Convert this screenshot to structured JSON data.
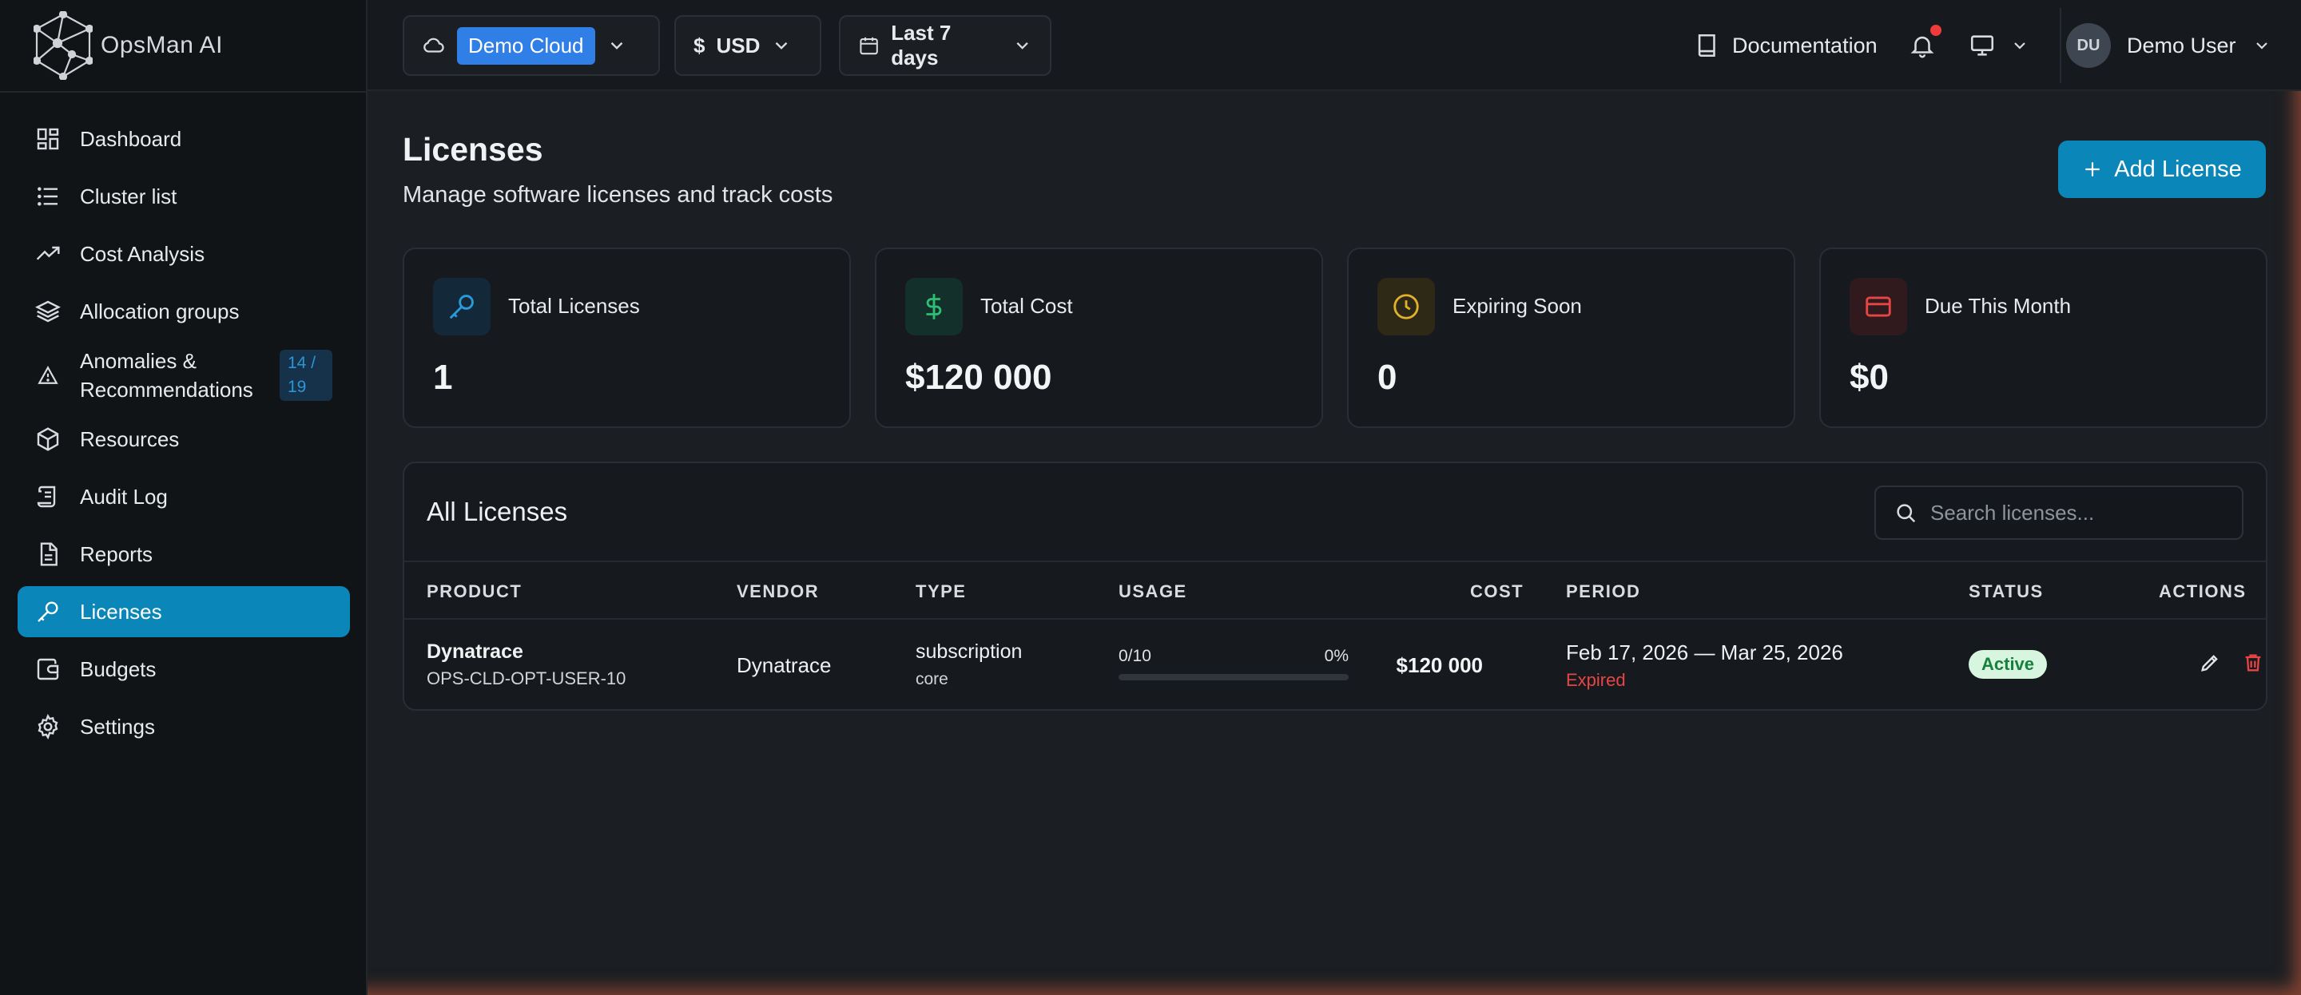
{
  "app": {
    "name": "OpsMan AI"
  },
  "sidebar": {
    "items": [
      {
        "label": "Dashboard",
        "icon": "dashboard-icon"
      },
      {
        "label": "Cluster list",
        "icon": "list-icon"
      },
      {
        "label": "Cost Analysis",
        "icon": "trend-icon"
      },
      {
        "label": "Allocation groups",
        "icon": "layers-icon"
      },
      {
        "label_line1": "Anomalies &",
        "label_line2": "Recommendations",
        "badge_line1": "14 /",
        "badge_line2": "19",
        "icon": "warning-icon"
      },
      {
        "label": "Resources",
        "icon": "cube-icon"
      },
      {
        "label": "Audit Log",
        "icon": "scroll-icon"
      },
      {
        "label": "Reports",
        "icon": "report-icon"
      },
      {
        "label": "Licenses",
        "icon": "key-icon",
        "active": true
      },
      {
        "label": "Budgets",
        "icon": "wallet-icon"
      },
      {
        "label": "Settings",
        "icon": "gear-icon"
      }
    ]
  },
  "topbar": {
    "cloud": "Demo Cloud",
    "currency_symbol": "$",
    "currency": "USD",
    "date_range": "Last 7 days",
    "documentation": "Documentation",
    "user_initials": "DU",
    "user_name": "Demo User"
  },
  "page": {
    "title": "Licenses",
    "subtitle": "Manage software licenses and track costs",
    "add_button": "Add License"
  },
  "stats": [
    {
      "label": "Total Licenses",
      "value": "1",
      "icon": "key-icon",
      "color": "#2a9ad8"
    },
    {
      "label": "Total Cost",
      "value": "$120 000",
      "icon": "dollar-icon",
      "color": "#2fbf74"
    },
    {
      "label": "Expiring Soon",
      "value": "0",
      "icon": "clock-icon",
      "color": "#e0b12a"
    },
    {
      "label": "Due This Month",
      "value": "$0",
      "icon": "credit-card-icon",
      "color": "#e84545"
    }
  ],
  "table": {
    "title": "All Licenses",
    "search_placeholder": "Search licenses...",
    "columns": [
      "PRODUCT",
      "VENDOR",
      "TYPE",
      "USAGE",
      "COST",
      "PERIOD",
      "STATUS",
      "ACTIONS"
    ],
    "rows": [
      {
        "product": "Dynatrace",
        "sku": "OPS-CLD-OPT-USER-10",
        "vendor": "Dynatrace",
        "type": "subscription",
        "subtype": "core",
        "usage": "0/10",
        "usage_pct": "0%",
        "usage_fraction": 0,
        "cost": "$120 000",
        "period": "Feb 17, 2026 — Mar 25, 2026",
        "period_note": "Expired",
        "status": "Active"
      }
    ]
  }
}
